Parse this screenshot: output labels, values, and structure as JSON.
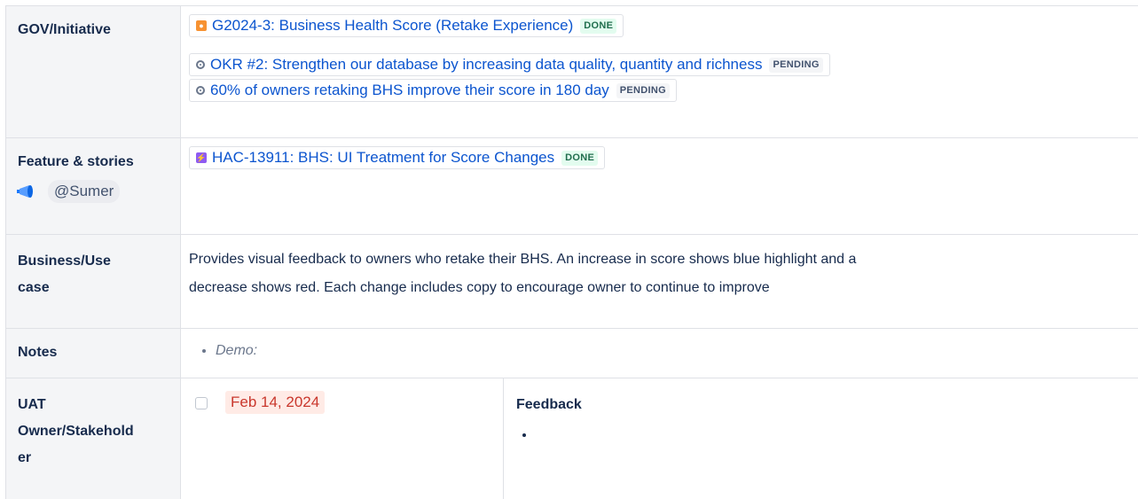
{
  "rows": {
    "gov": {
      "label": "GOV/Initiative",
      "items": [
        {
          "text": "G2024-3: Business Health Score (Retake Experience)",
          "status": "DONE",
          "icon": "initiative-icon"
        },
        {
          "text": "OKR #2: Strengthen our database by increasing data quality, quantity and richness",
          "status": "PENDING",
          "icon": "target-icon"
        },
        {
          "text": "60% of owners retaking BHS improve their score in 180 day",
          "status": "PENDING",
          "icon": "target-icon"
        }
      ]
    },
    "feature": {
      "label": "Feature & stories",
      "mention": "@Sumer",
      "items": [
        {
          "text": "HAC-13911: BHS: UI Treatment for Score Changes",
          "status": "DONE",
          "icon": "story-icon"
        }
      ]
    },
    "business": {
      "label_line1": "Business/Use",
      "label_line2": "case",
      "text_line1": "Provides visual feedback to owners who retake their BHS. An increase in score shows blue highlight and a",
      "text_line2": "decrease shows red. Each change includes copy to encourage owner to continue to improve"
    },
    "notes": {
      "label": "Notes",
      "items": [
        "Demo:"
      ]
    },
    "uat": {
      "label_line1": "UAT",
      "label_line2": "Owner/Stakehold",
      "label_line3": "er",
      "date": "Feb 14, 2024",
      "feedback_title": "Feedback"
    }
  },
  "colors": {
    "link": "#0c55cf",
    "done_bg": "#e3fcef",
    "done_text": "#216e4e",
    "pending_bg": "#f4f5f7",
    "header_bg": "#f4f5f7",
    "date_bg": "#ffebe6",
    "date_text": "#c9372c"
  }
}
